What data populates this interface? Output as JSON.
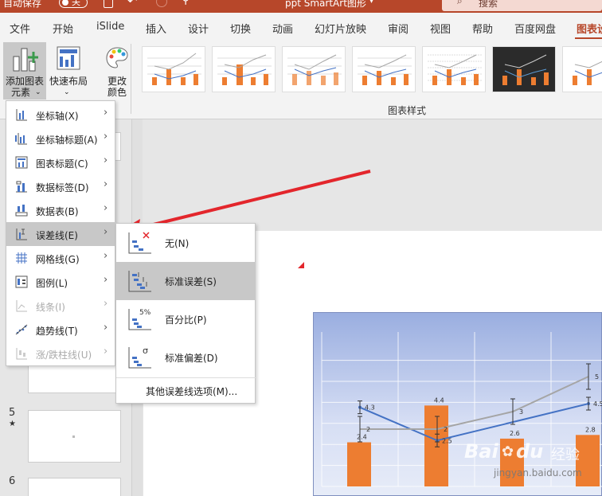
{
  "titlebar": {
    "autosave": "自动保存",
    "toggle": "关",
    "file": "ppt SmartArt图形",
    "search": "搜索"
  },
  "tabs": [
    "文件",
    "开始",
    "iSlide",
    "插入",
    "设计",
    "切换",
    "动画",
    "幻灯片放映",
    "审阅",
    "视图",
    "帮助",
    "百度网盘",
    "图表设"
  ],
  "ribbon": {
    "add_element": "添加图表",
    "add_element2": "元素",
    "quick_layout": "快速布局",
    "change_color": "更改",
    "change_color2": "颜色",
    "group_label": "图表样式"
  },
  "menu": [
    {
      "label": "坐标轴(X)",
      "icon": "axis-icon",
      "enabled": true
    },
    {
      "label": "坐标轴标题(A)",
      "icon": "axis-title-icon",
      "enabled": true
    },
    {
      "label": "图表标题(C)",
      "icon": "chart-title-icon",
      "enabled": true
    },
    {
      "label": "数据标签(D)",
      "icon": "data-label-icon",
      "enabled": true
    },
    {
      "label": "数据表(B)",
      "icon": "data-table-icon",
      "enabled": true
    },
    {
      "label": "误差线(E)",
      "icon": "error-bar-icon",
      "enabled": true
    },
    {
      "label": "网格线(G)",
      "icon": "gridline-icon",
      "enabled": true
    },
    {
      "label": "图例(L)",
      "icon": "legend-icon",
      "enabled": true
    },
    {
      "label": "线条(I)",
      "icon": "lines-icon",
      "enabled": false
    },
    {
      "label": "趋势线(T)",
      "icon": "trendline-icon",
      "enabled": true
    },
    {
      "label": "涨/跌柱线(U)",
      "icon": "updown-bars-icon",
      "enabled": false
    }
  ],
  "submenu": [
    {
      "label": "无(N)",
      "badge": ""
    },
    {
      "label": "标准误差(S)",
      "badge": ""
    },
    {
      "label": "百分比(P)",
      "badge": "5%"
    },
    {
      "label": "标准偏差(D)",
      "badge": "σ"
    }
  ],
  "submenu_more": "其他误差线选项(M)...",
  "slides": [
    {
      "num": "5",
      "star": "★"
    },
    {
      "num": "6"
    }
  ],
  "chart_data": {
    "type": "bar",
    "series": [
      {
        "type": "bar",
        "values": [
          2.4,
          4.4,
          2.6,
          2.8
        ]
      },
      {
        "type": "line",
        "values": [
          4.3,
          2.5,
          null,
          4.5
        ]
      },
      {
        "type": "line",
        "values": [
          2,
          2,
          3,
          5
        ]
      }
    ],
    "labels": {
      "bars": [
        "2.4",
        "4.4",
        "2.6",
        "2.8"
      ],
      "blue": [
        "4.3",
        "2.5",
        "4.5"
      ],
      "gray": [
        "2",
        "2",
        "3",
        "5"
      ]
    }
  },
  "watermark": {
    "brand": "Bai",
    "du": "du",
    "cn": "经验",
    "url": "jingyan.baidu.com"
  },
  "colors": {
    "accent": "#b7472a",
    "bar": "#ed7d31",
    "line_blue": "#4472c4",
    "line_gray": "#a5a5a5",
    "arrow": "#e3262c"
  }
}
